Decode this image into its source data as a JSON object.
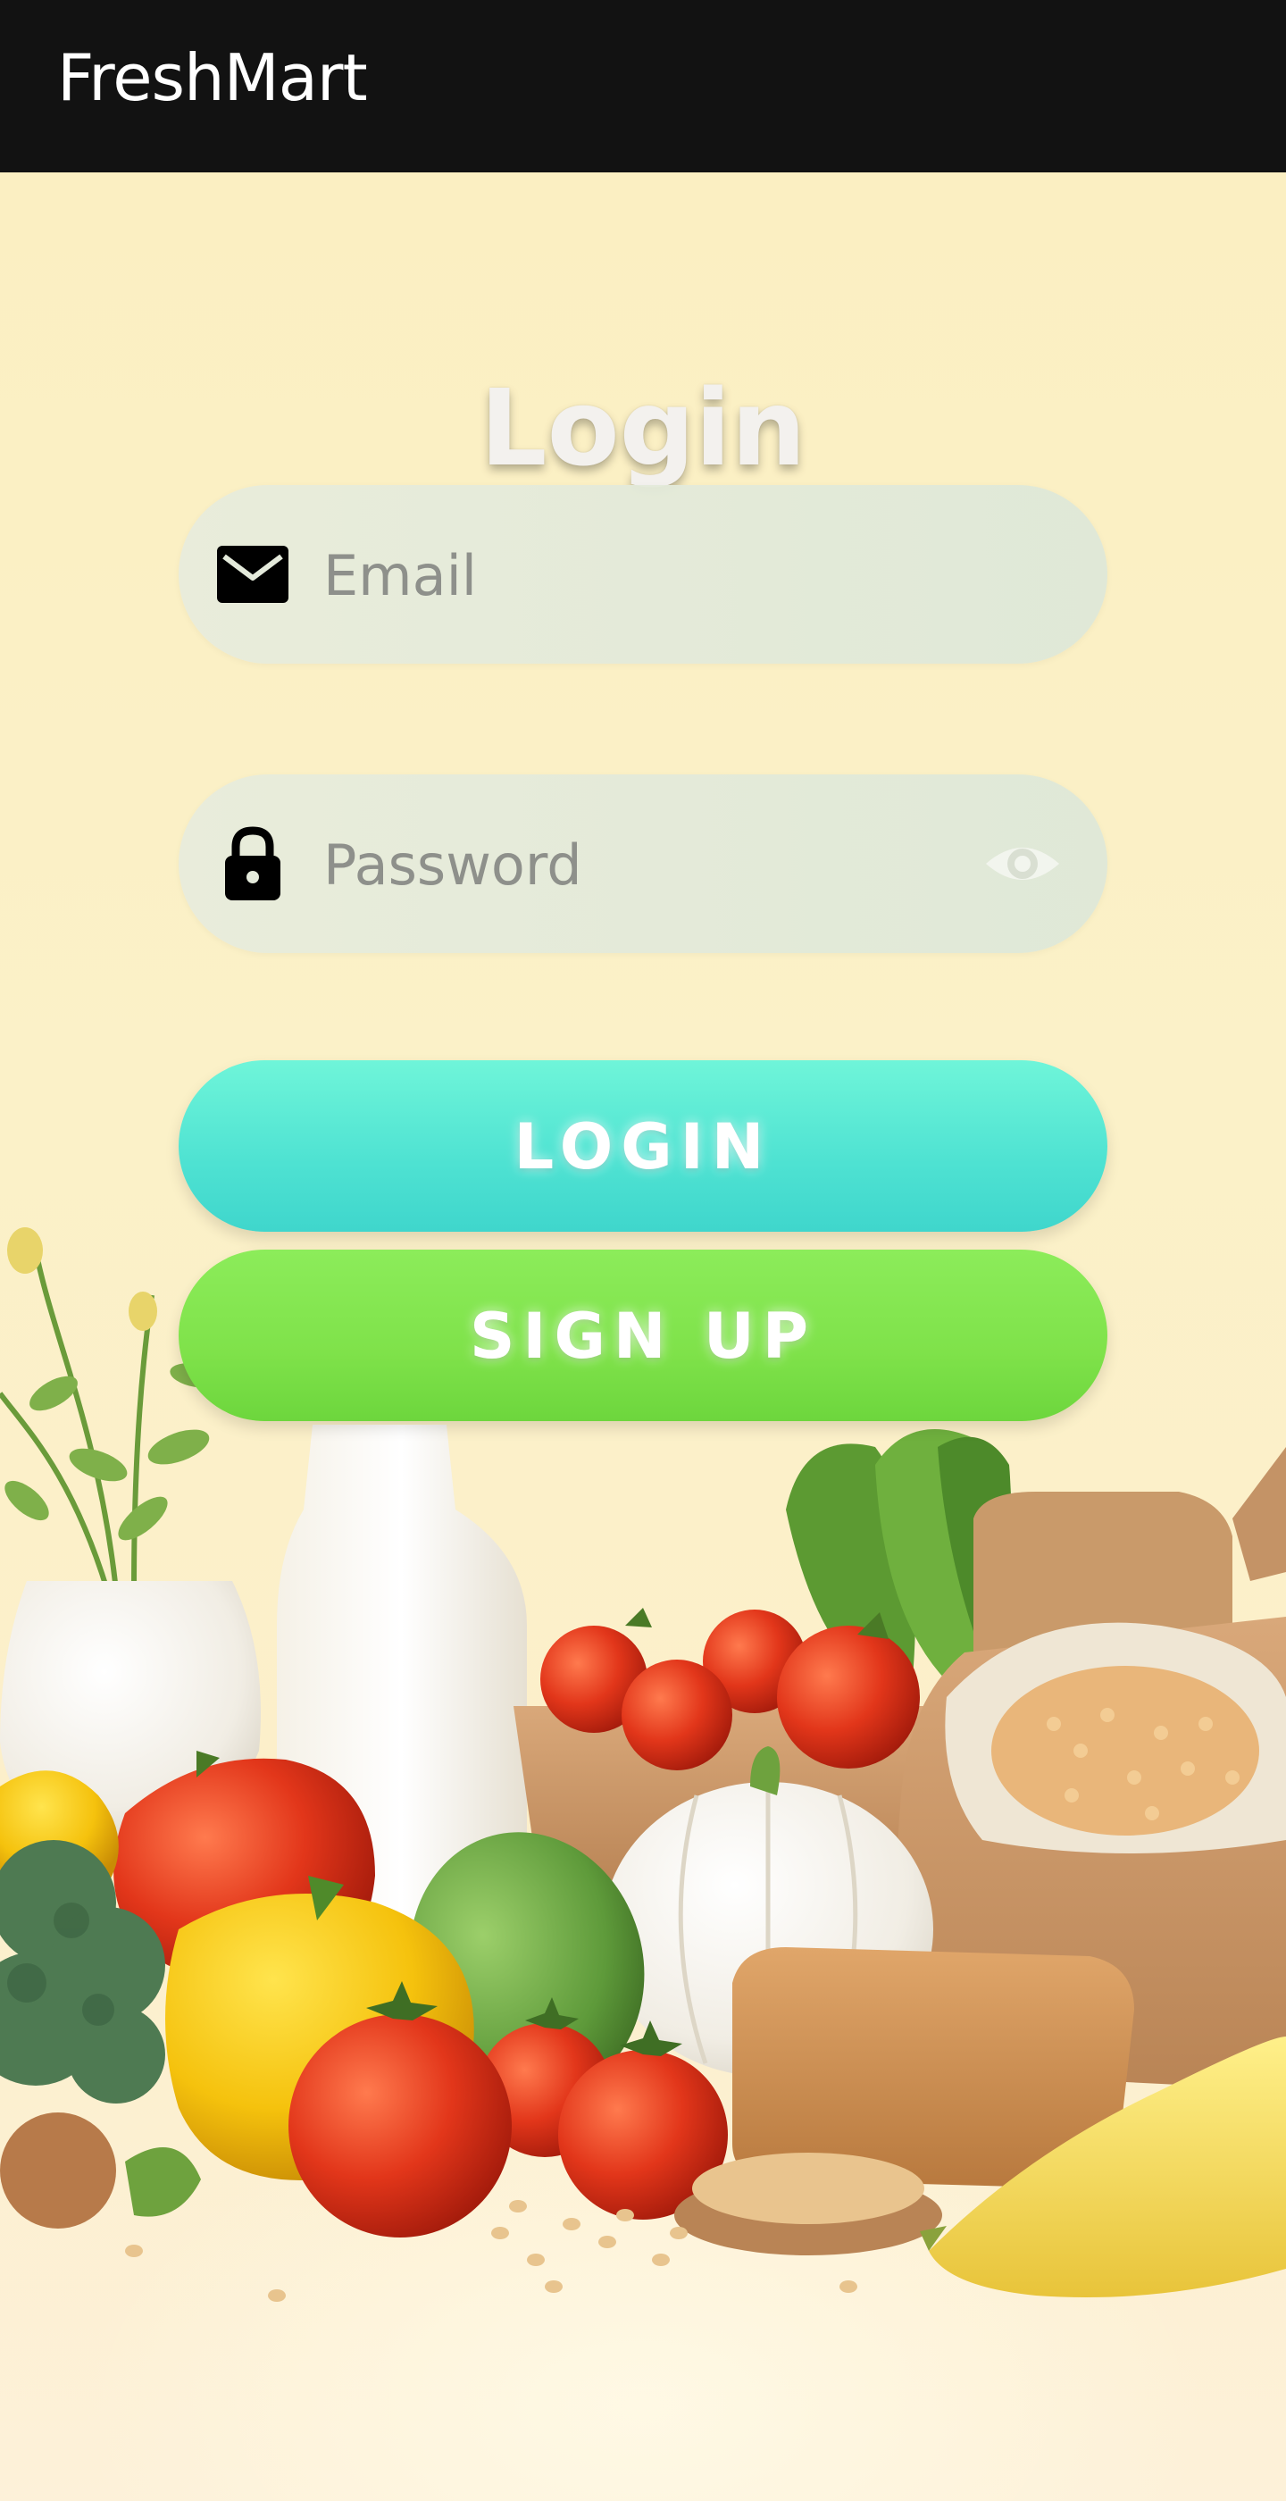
{
  "header": {
    "brand": "FreshMart"
  },
  "login": {
    "title": "Login",
    "email": {
      "placeholder": "Email",
      "value": "",
      "icon": "envelope-icon"
    },
    "password": {
      "placeholder": "Password",
      "value": "",
      "icon": "lock-icon",
      "toggle_icon": "eye-icon"
    },
    "login_button": "LOGIN",
    "signup_button": "SIGN UP"
  },
  "colors": {
    "header_bg": "#121212",
    "background": "#fbefc4",
    "login_button": "#4ee2d2",
    "signup_button": "#7fe24a"
  }
}
